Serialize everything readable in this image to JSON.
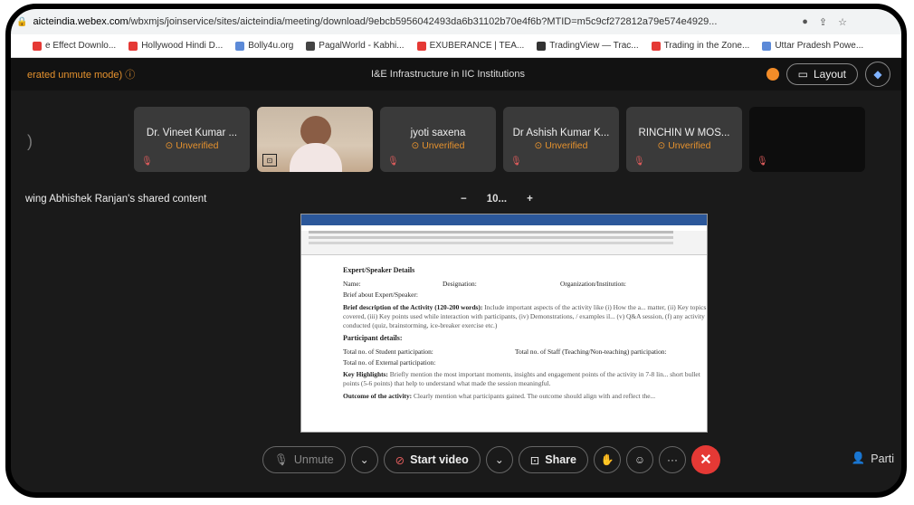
{
  "browser": {
    "url_domain": "aicteindia.webex.com",
    "url_path": "/wbxmjs/joinservice/sites/aicteindia/meeting/download/9ebcb5956042493da6b31102b70e4f6b?MTID=m5c9cf272812a79e574e4929...",
    "bookmarks": [
      {
        "label": "e Effect Downlo...",
        "color": "#e53935"
      },
      {
        "label": "Hollywood Hindi D...",
        "color": "#e53935"
      },
      {
        "label": "Bolly4u.org",
        "color": "#5c8ad8"
      },
      {
        "label": "PagalWorld - Kabhi...",
        "color": "#444"
      },
      {
        "label": "EXUBERANCE | TEA...",
        "color": "#e53935"
      },
      {
        "label": "TradingView — Trac...",
        "color": "#333"
      },
      {
        "label": "Trading in the Zone...",
        "color": "#e53935"
      },
      {
        "label": "Uttar Pradesh Powe...",
        "color": "#5c8ad8"
      }
    ]
  },
  "meeting": {
    "mode_text": "erated unmute mode) ⓘ",
    "title": "I&E Infrastructure in IIC Institutions",
    "layout_label": "Layout"
  },
  "participants": [
    {
      "name": "Dr. Vineet Kumar ...",
      "status": "⊙ Unverified",
      "type": "name"
    },
    {
      "name": "",
      "status": "",
      "type": "video"
    },
    {
      "name": "jyoti saxena",
      "status": "⊙ Unverified",
      "type": "name"
    },
    {
      "name": "Dr Ashish Kumar K...",
      "status": "⊙ Unverified",
      "type": "name"
    },
    {
      "name": "RINCHIN W MOS...",
      "status": "⊙ Unverified",
      "type": "name"
    },
    {
      "name": "",
      "status": "",
      "type": "dark"
    }
  ],
  "share": {
    "label": "wing Abhishek Ranjan's shared content",
    "zoom_minus": "−",
    "zoom_value": "10...",
    "zoom_plus": "+"
  },
  "document": {
    "h1": "Expert/Speaker Details",
    "row": [
      "Name:",
      "Designation:",
      "Organization/Institution:"
    ],
    "brief": "Brief about Expert/Speaker:",
    "desc_title": "Brief description of the Activity (120-200 words):",
    "desc_text": "Include important aspects of the activity like (i) How the a... matter, (ii) Key topics covered, (iii) Key points used while interaction with participants, (iv) Demonstrations, / examples il... (v) Q&A session, (f) any activity conducted (quiz, brainstorming, ice-breaker exercise etc.)",
    "participants_title": "Participant details:",
    "students": "Total no. of Student participation:",
    "staff": "Total no. of Staff (Teaching/Non-teaching) participation:",
    "external": "Total no. of External participation:",
    "highlights_title": "Key Highlights:",
    "highlights_text": "Briefly mention the most important moments, insights and engagement points of the activity in 7-8 lin... short bullet points (5-6 points) that help to understand what made the session meaningful.",
    "outcome_title": "Outcome of the activity:",
    "outcome_text": "Clearly mention what participants gained. The outcome should align with and reflect the..."
  },
  "controls": {
    "unmute": "Unmute",
    "start_video": "Start video",
    "share": "Share",
    "participants": "Parti"
  }
}
